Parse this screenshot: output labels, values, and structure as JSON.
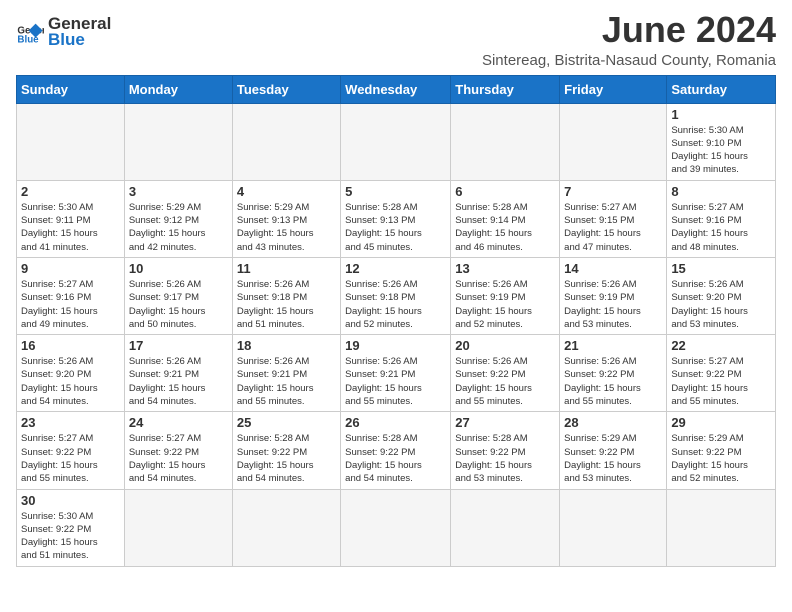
{
  "logo": {
    "text_general": "General",
    "text_blue": "Blue"
  },
  "title": "June 2024",
  "subtitle": "Sintereag, Bistrita-Nasaud County, Romania",
  "headers": [
    "Sunday",
    "Monday",
    "Tuesday",
    "Wednesday",
    "Thursday",
    "Friday",
    "Saturday"
  ],
  "weeks": [
    [
      {
        "day": null,
        "info": null
      },
      {
        "day": null,
        "info": null
      },
      {
        "day": null,
        "info": null
      },
      {
        "day": null,
        "info": null
      },
      {
        "day": null,
        "info": null
      },
      {
        "day": null,
        "info": null
      },
      {
        "day": "1",
        "info": "Sunrise: 5:30 AM\nSunset: 9:10 PM\nDaylight: 15 hours\nand 39 minutes."
      }
    ],
    [
      {
        "day": "2",
        "info": "Sunrise: 5:30 AM\nSunset: 9:11 PM\nDaylight: 15 hours\nand 41 minutes."
      },
      {
        "day": "3",
        "info": "Sunrise: 5:29 AM\nSunset: 9:12 PM\nDaylight: 15 hours\nand 42 minutes."
      },
      {
        "day": "4",
        "info": "Sunrise: 5:29 AM\nSunset: 9:13 PM\nDaylight: 15 hours\nand 43 minutes."
      },
      {
        "day": "5",
        "info": "Sunrise: 5:28 AM\nSunset: 9:13 PM\nDaylight: 15 hours\nand 45 minutes."
      },
      {
        "day": "6",
        "info": "Sunrise: 5:28 AM\nSunset: 9:14 PM\nDaylight: 15 hours\nand 46 minutes."
      },
      {
        "day": "7",
        "info": "Sunrise: 5:27 AM\nSunset: 9:15 PM\nDaylight: 15 hours\nand 47 minutes."
      },
      {
        "day": "8",
        "info": "Sunrise: 5:27 AM\nSunset: 9:16 PM\nDaylight: 15 hours\nand 48 minutes."
      }
    ],
    [
      {
        "day": "9",
        "info": "Sunrise: 5:27 AM\nSunset: 9:16 PM\nDaylight: 15 hours\nand 49 minutes."
      },
      {
        "day": "10",
        "info": "Sunrise: 5:26 AM\nSunset: 9:17 PM\nDaylight: 15 hours\nand 50 minutes."
      },
      {
        "day": "11",
        "info": "Sunrise: 5:26 AM\nSunset: 9:18 PM\nDaylight: 15 hours\nand 51 minutes."
      },
      {
        "day": "12",
        "info": "Sunrise: 5:26 AM\nSunset: 9:18 PM\nDaylight: 15 hours\nand 52 minutes."
      },
      {
        "day": "13",
        "info": "Sunrise: 5:26 AM\nSunset: 9:19 PM\nDaylight: 15 hours\nand 52 minutes."
      },
      {
        "day": "14",
        "info": "Sunrise: 5:26 AM\nSunset: 9:19 PM\nDaylight: 15 hours\nand 53 minutes."
      },
      {
        "day": "15",
        "info": "Sunrise: 5:26 AM\nSunset: 9:20 PM\nDaylight: 15 hours\nand 53 minutes."
      }
    ],
    [
      {
        "day": "16",
        "info": "Sunrise: 5:26 AM\nSunset: 9:20 PM\nDaylight: 15 hours\nand 54 minutes."
      },
      {
        "day": "17",
        "info": "Sunrise: 5:26 AM\nSunset: 9:21 PM\nDaylight: 15 hours\nand 54 minutes."
      },
      {
        "day": "18",
        "info": "Sunrise: 5:26 AM\nSunset: 9:21 PM\nDaylight: 15 hours\nand 55 minutes."
      },
      {
        "day": "19",
        "info": "Sunrise: 5:26 AM\nSunset: 9:21 PM\nDaylight: 15 hours\nand 55 minutes."
      },
      {
        "day": "20",
        "info": "Sunrise: 5:26 AM\nSunset: 9:22 PM\nDaylight: 15 hours\nand 55 minutes."
      },
      {
        "day": "21",
        "info": "Sunrise: 5:26 AM\nSunset: 9:22 PM\nDaylight: 15 hours\nand 55 minutes."
      },
      {
        "day": "22",
        "info": "Sunrise: 5:27 AM\nSunset: 9:22 PM\nDaylight: 15 hours\nand 55 minutes."
      }
    ],
    [
      {
        "day": "23",
        "info": "Sunrise: 5:27 AM\nSunset: 9:22 PM\nDaylight: 15 hours\nand 55 minutes."
      },
      {
        "day": "24",
        "info": "Sunrise: 5:27 AM\nSunset: 9:22 PM\nDaylight: 15 hours\nand 54 minutes."
      },
      {
        "day": "25",
        "info": "Sunrise: 5:28 AM\nSunset: 9:22 PM\nDaylight: 15 hours\nand 54 minutes."
      },
      {
        "day": "26",
        "info": "Sunrise: 5:28 AM\nSunset: 9:22 PM\nDaylight: 15 hours\nand 54 minutes."
      },
      {
        "day": "27",
        "info": "Sunrise: 5:28 AM\nSunset: 9:22 PM\nDaylight: 15 hours\nand 53 minutes."
      },
      {
        "day": "28",
        "info": "Sunrise: 5:29 AM\nSunset: 9:22 PM\nDaylight: 15 hours\nand 53 minutes."
      },
      {
        "day": "29",
        "info": "Sunrise: 5:29 AM\nSunset: 9:22 PM\nDaylight: 15 hours\nand 52 minutes."
      }
    ],
    [
      {
        "day": "30",
        "info": "Sunrise: 5:30 AM\nSunset: 9:22 PM\nDaylight: 15 hours\nand 51 minutes."
      },
      {
        "day": null,
        "info": null
      },
      {
        "day": null,
        "info": null
      },
      {
        "day": null,
        "info": null
      },
      {
        "day": null,
        "info": null
      },
      {
        "day": null,
        "info": null
      },
      {
        "day": null,
        "info": null
      }
    ]
  ]
}
